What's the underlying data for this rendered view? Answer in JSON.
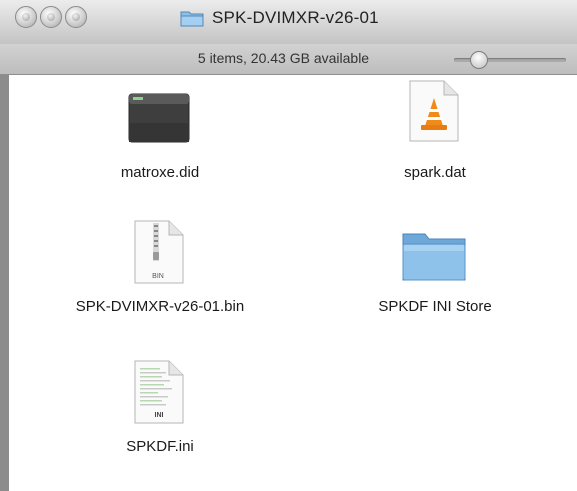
{
  "window": {
    "title": "SPK-DVIMXR-v26-01",
    "status": "5 items, 20.43 GB available",
    "zoom_level": 0.15
  },
  "items": [
    {
      "name": "matroxe.did",
      "icon": "unix-executable-icon"
    },
    {
      "name": "spark.dat",
      "icon": "vlc-document-icon"
    },
    {
      "name": "SPK-DVIMXR-v26-01.bin",
      "icon": "zip-bin-document-icon",
      "badge": "BIN"
    },
    {
      "name": "SPKDF INI Store",
      "icon": "folder-icon"
    },
    {
      "name": "SPKDF.ini",
      "icon": "ini-document-icon",
      "badge": "INI"
    }
  ],
  "colors": {
    "folder": "#7cb3e0",
    "vlc_orange": "#f08a1a"
  }
}
